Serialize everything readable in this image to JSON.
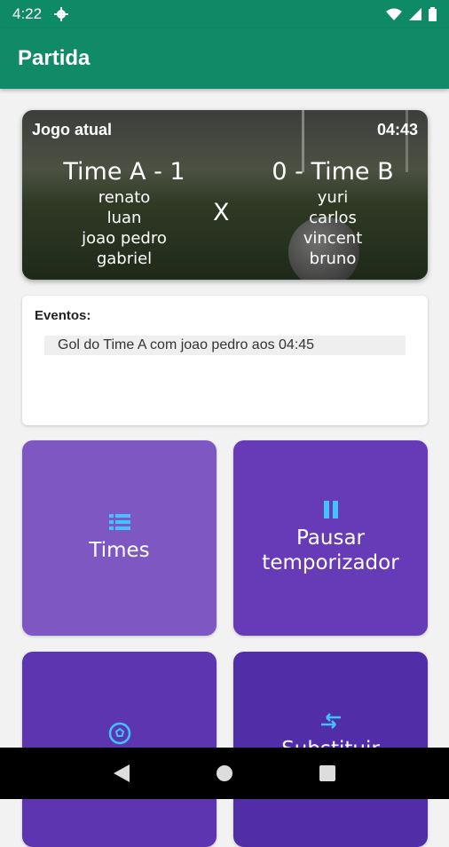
{
  "status": {
    "time": "4:22"
  },
  "appbar": {
    "title": "Partida"
  },
  "match": {
    "label": "Jogo atual",
    "timer": "04:43",
    "team_a": {
      "name": "Time A - 1",
      "players": [
        "renato",
        "luan",
        "joao pedro",
        "gabriel"
      ]
    },
    "team_b": {
      "name": "0 - Time B",
      "players": [
        "yuri",
        "carlos",
        "vincent",
        "bruno"
      ]
    },
    "vs": "X"
  },
  "events": {
    "label": "Eventos:",
    "items": [
      "Gol do Time A com joao pedro aos 04:45"
    ]
  },
  "tiles": [
    {
      "label": "Times",
      "icon": "list-icon"
    },
    {
      "label": "Pausar temporizador",
      "icon": "pause-icon"
    },
    {
      "label": "",
      "icon": "soccer-ball-icon"
    },
    {
      "label": "Substituir",
      "icon": "swap-icon"
    }
  ],
  "colors": {
    "appbar": "#118a68",
    "tile_icon": "#40c4ff"
  }
}
